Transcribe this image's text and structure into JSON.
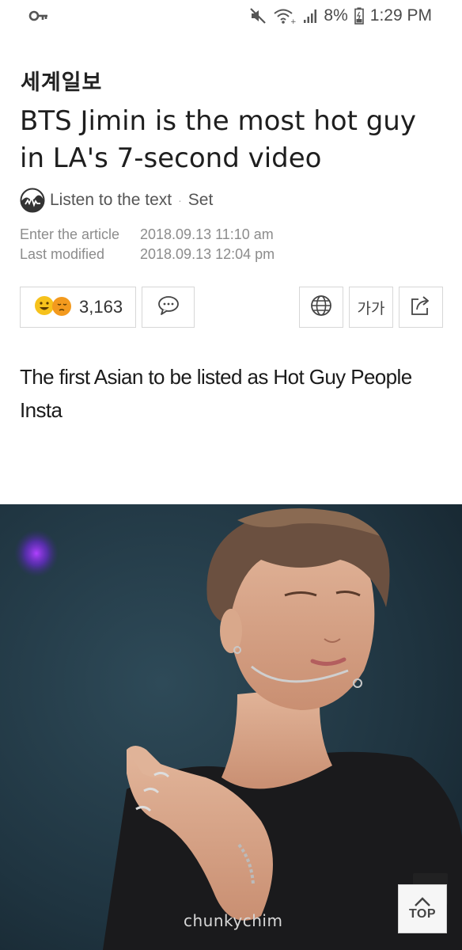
{
  "status_bar": {
    "battery_percent": "8%",
    "time": "1:29 PM",
    "icons": [
      "key-icon",
      "mute-icon",
      "wifi-icon",
      "signal-icon",
      "battery-icon"
    ]
  },
  "article": {
    "publisher": "세계일보",
    "headline": "BTS Jimin is the most hot guy in LA's 7-second video",
    "tts": {
      "listen_label": "Listen to the text",
      "separator": "·",
      "set_label": "Set"
    },
    "dates": {
      "entered_label": "Enter the article",
      "entered_value": "2018.09.13 11:10 am",
      "modified_label": "Last modified",
      "modified_value": "2018.09.13 12:04 pm"
    },
    "actions": {
      "reaction_count": "3,163",
      "font_size_label": "가가"
    },
    "body": "The first Asian to be listed as Hot Guy People Insta"
  },
  "photo": {
    "watermark": "chunkychim",
    "top_button_label": "TOP"
  },
  "colors": {
    "text": "#1e1e1e",
    "muted": "#8c8c8c",
    "border": "#d7d7d7",
    "emoji_yellow": "#f6c21c",
    "emoji_orange": "#f39a1e"
  }
}
